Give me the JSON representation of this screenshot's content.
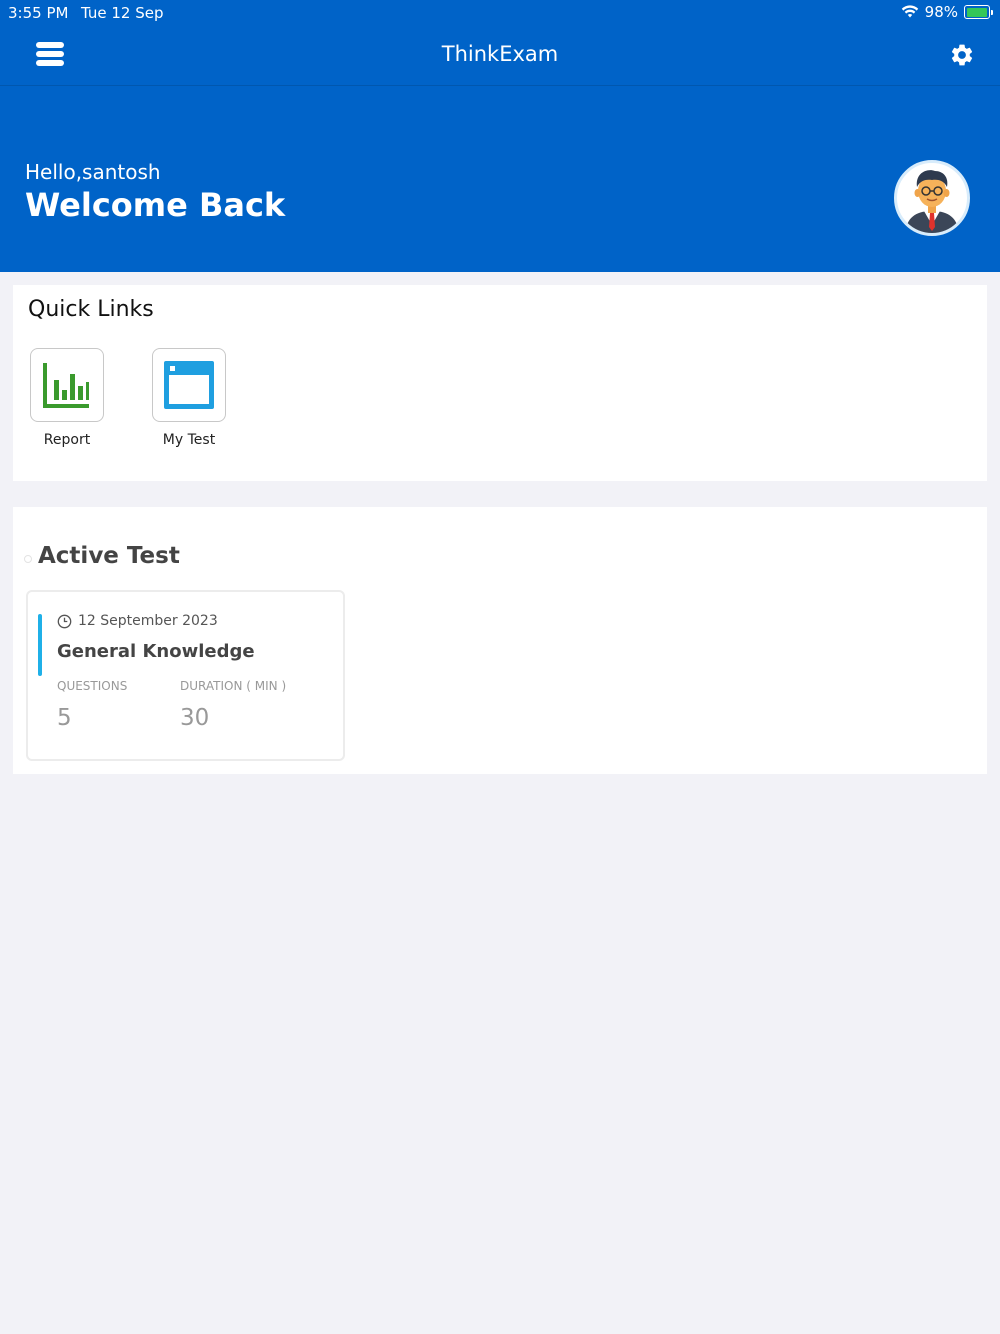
{
  "status_bar": {
    "time": "3:55 PM",
    "date": "Tue 12 Sep",
    "battery": "98%",
    "battery_level": 0.98
  },
  "header": {
    "title": "ThinkExam"
  },
  "greeting": {
    "hello": "Hello,santosh",
    "welcome": "Welcome Back"
  },
  "quick_links": {
    "title": "Quick Links",
    "items": [
      {
        "label": "Report",
        "icon": "bar-chart-icon"
      },
      {
        "label": "My Test",
        "icon": "browser-window-icon"
      }
    ]
  },
  "active_test": {
    "title": "Active Test",
    "card": {
      "date": "12 September 2023",
      "name": "General Knowledge",
      "questions_label": "QUESTIONS",
      "questions_value": "5",
      "duration_label": "DURATION ( MIN )",
      "duration_value": "30"
    }
  },
  "colors": {
    "primary": "#0063c8",
    "accent": "#1fb0e8",
    "report_icon": "#3a9a2d",
    "background": "#f2f2f7"
  }
}
